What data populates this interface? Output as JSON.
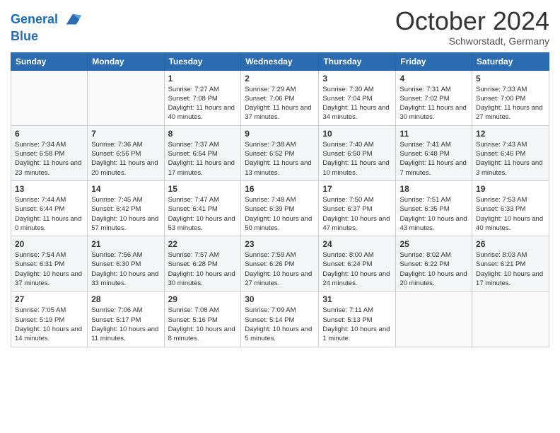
{
  "logo": {
    "line1": "General",
    "line2": "Blue"
  },
  "title": "October 2024",
  "location": "Schworstadt, Germany",
  "headers": [
    "Sunday",
    "Monday",
    "Tuesday",
    "Wednesday",
    "Thursday",
    "Friday",
    "Saturday"
  ],
  "weeks": [
    [
      {
        "day": "",
        "info": ""
      },
      {
        "day": "",
        "info": ""
      },
      {
        "day": "1",
        "sunrise": "Sunrise: 7:27 AM",
        "sunset": "Sunset: 7:08 PM",
        "daylight": "Daylight: 11 hours and 40 minutes."
      },
      {
        "day": "2",
        "sunrise": "Sunrise: 7:29 AM",
        "sunset": "Sunset: 7:06 PM",
        "daylight": "Daylight: 11 hours and 37 minutes."
      },
      {
        "day": "3",
        "sunrise": "Sunrise: 7:30 AM",
        "sunset": "Sunset: 7:04 PM",
        "daylight": "Daylight: 11 hours and 34 minutes."
      },
      {
        "day": "4",
        "sunrise": "Sunrise: 7:31 AM",
        "sunset": "Sunset: 7:02 PM",
        "daylight": "Daylight: 11 hours and 30 minutes."
      },
      {
        "day": "5",
        "sunrise": "Sunrise: 7:33 AM",
        "sunset": "Sunset: 7:00 PM",
        "daylight": "Daylight: 11 hours and 27 minutes."
      }
    ],
    [
      {
        "day": "6",
        "sunrise": "Sunrise: 7:34 AM",
        "sunset": "Sunset: 6:58 PM",
        "daylight": "Daylight: 11 hours and 23 minutes."
      },
      {
        "day": "7",
        "sunrise": "Sunrise: 7:36 AM",
        "sunset": "Sunset: 6:56 PM",
        "daylight": "Daylight: 11 hours and 20 minutes."
      },
      {
        "day": "8",
        "sunrise": "Sunrise: 7:37 AM",
        "sunset": "Sunset: 6:54 PM",
        "daylight": "Daylight: 11 hours and 17 minutes."
      },
      {
        "day": "9",
        "sunrise": "Sunrise: 7:38 AM",
        "sunset": "Sunset: 6:52 PM",
        "daylight": "Daylight: 11 hours and 13 minutes."
      },
      {
        "day": "10",
        "sunrise": "Sunrise: 7:40 AM",
        "sunset": "Sunset: 6:50 PM",
        "daylight": "Daylight: 11 hours and 10 minutes."
      },
      {
        "day": "11",
        "sunrise": "Sunrise: 7:41 AM",
        "sunset": "Sunset: 6:48 PM",
        "daylight": "Daylight: 11 hours and 7 minutes."
      },
      {
        "day": "12",
        "sunrise": "Sunrise: 7:43 AM",
        "sunset": "Sunset: 6:46 PM",
        "daylight": "Daylight: 11 hours and 3 minutes."
      }
    ],
    [
      {
        "day": "13",
        "sunrise": "Sunrise: 7:44 AM",
        "sunset": "Sunset: 6:44 PM",
        "daylight": "Daylight: 11 hours and 0 minutes."
      },
      {
        "day": "14",
        "sunrise": "Sunrise: 7:45 AM",
        "sunset": "Sunset: 6:42 PM",
        "daylight": "Daylight: 10 hours and 57 minutes."
      },
      {
        "day": "15",
        "sunrise": "Sunrise: 7:47 AM",
        "sunset": "Sunset: 6:41 PM",
        "daylight": "Daylight: 10 hours and 53 minutes."
      },
      {
        "day": "16",
        "sunrise": "Sunrise: 7:48 AM",
        "sunset": "Sunset: 6:39 PM",
        "daylight": "Daylight: 10 hours and 50 minutes."
      },
      {
        "day": "17",
        "sunrise": "Sunrise: 7:50 AM",
        "sunset": "Sunset: 6:37 PM",
        "daylight": "Daylight: 10 hours and 47 minutes."
      },
      {
        "day": "18",
        "sunrise": "Sunrise: 7:51 AM",
        "sunset": "Sunset: 6:35 PM",
        "daylight": "Daylight: 10 hours and 43 minutes."
      },
      {
        "day": "19",
        "sunrise": "Sunrise: 7:53 AM",
        "sunset": "Sunset: 6:33 PM",
        "daylight": "Daylight: 10 hours and 40 minutes."
      }
    ],
    [
      {
        "day": "20",
        "sunrise": "Sunrise: 7:54 AM",
        "sunset": "Sunset: 6:31 PM",
        "daylight": "Daylight: 10 hours and 37 minutes."
      },
      {
        "day": "21",
        "sunrise": "Sunrise: 7:56 AM",
        "sunset": "Sunset: 6:30 PM",
        "daylight": "Daylight: 10 hours and 33 minutes."
      },
      {
        "day": "22",
        "sunrise": "Sunrise: 7:57 AM",
        "sunset": "Sunset: 6:28 PM",
        "daylight": "Daylight: 10 hours and 30 minutes."
      },
      {
        "day": "23",
        "sunrise": "Sunrise: 7:59 AM",
        "sunset": "Sunset: 6:26 PM",
        "daylight": "Daylight: 10 hours and 27 minutes."
      },
      {
        "day": "24",
        "sunrise": "Sunrise: 8:00 AM",
        "sunset": "Sunset: 6:24 PM",
        "daylight": "Daylight: 10 hours and 24 minutes."
      },
      {
        "day": "25",
        "sunrise": "Sunrise: 8:02 AM",
        "sunset": "Sunset: 6:22 PM",
        "daylight": "Daylight: 10 hours and 20 minutes."
      },
      {
        "day": "26",
        "sunrise": "Sunrise: 8:03 AM",
        "sunset": "Sunset: 6:21 PM",
        "daylight": "Daylight: 10 hours and 17 minutes."
      }
    ],
    [
      {
        "day": "27",
        "sunrise": "Sunrise: 7:05 AM",
        "sunset": "Sunset: 5:19 PM",
        "daylight": "Daylight: 10 hours and 14 minutes."
      },
      {
        "day": "28",
        "sunrise": "Sunrise: 7:06 AM",
        "sunset": "Sunset: 5:17 PM",
        "daylight": "Daylight: 10 hours and 11 minutes."
      },
      {
        "day": "29",
        "sunrise": "Sunrise: 7:08 AM",
        "sunset": "Sunset: 5:16 PM",
        "daylight": "Daylight: 10 hours and 8 minutes."
      },
      {
        "day": "30",
        "sunrise": "Sunrise: 7:09 AM",
        "sunset": "Sunset: 5:14 PM",
        "daylight": "Daylight: 10 hours and 5 minutes."
      },
      {
        "day": "31",
        "sunrise": "Sunrise: 7:11 AM",
        "sunset": "Sunset: 5:13 PM",
        "daylight": "Daylight: 10 hours and 1 minute."
      },
      {
        "day": "",
        "info": ""
      },
      {
        "day": "",
        "info": ""
      }
    ]
  ]
}
